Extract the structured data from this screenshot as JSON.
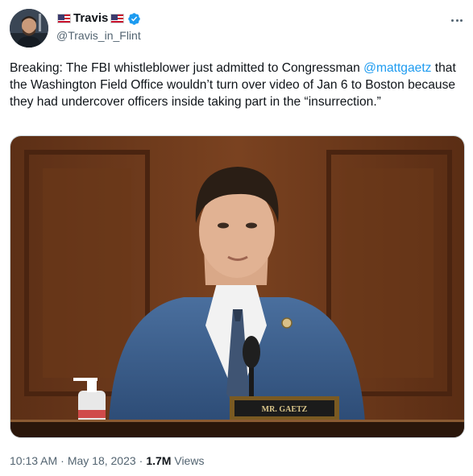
{
  "author": {
    "display_name": "Travis",
    "handle": "@Travis_in_Flint",
    "flag_icon": "us-flag-icon",
    "verified_color": "#1d9bf0"
  },
  "tweet": {
    "text_before": "Breaking: The FBI whistleblower just admitted to Congressman ",
    "mention": "@mattgaetz",
    "text_after": " that the Washington Field Office wouldn’t turn over video of Jan 6 to Boston because they had undercover officers inside taking part in the “insurrection.”"
  },
  "media": {
    "nameplate": "MR. GAETZ"
  },
  "meta": {
    "time": "10:13 AM",
    "separator": "·",
    "date": "May 18, 2023",
    "views_count": "1.7M",
    "views_label": "Views"
  },
  "colors": {
    "link": "#1d9bf0",
    "secondary_text": "#536471",
    "primary_text": "#0f1419"
  }
}
